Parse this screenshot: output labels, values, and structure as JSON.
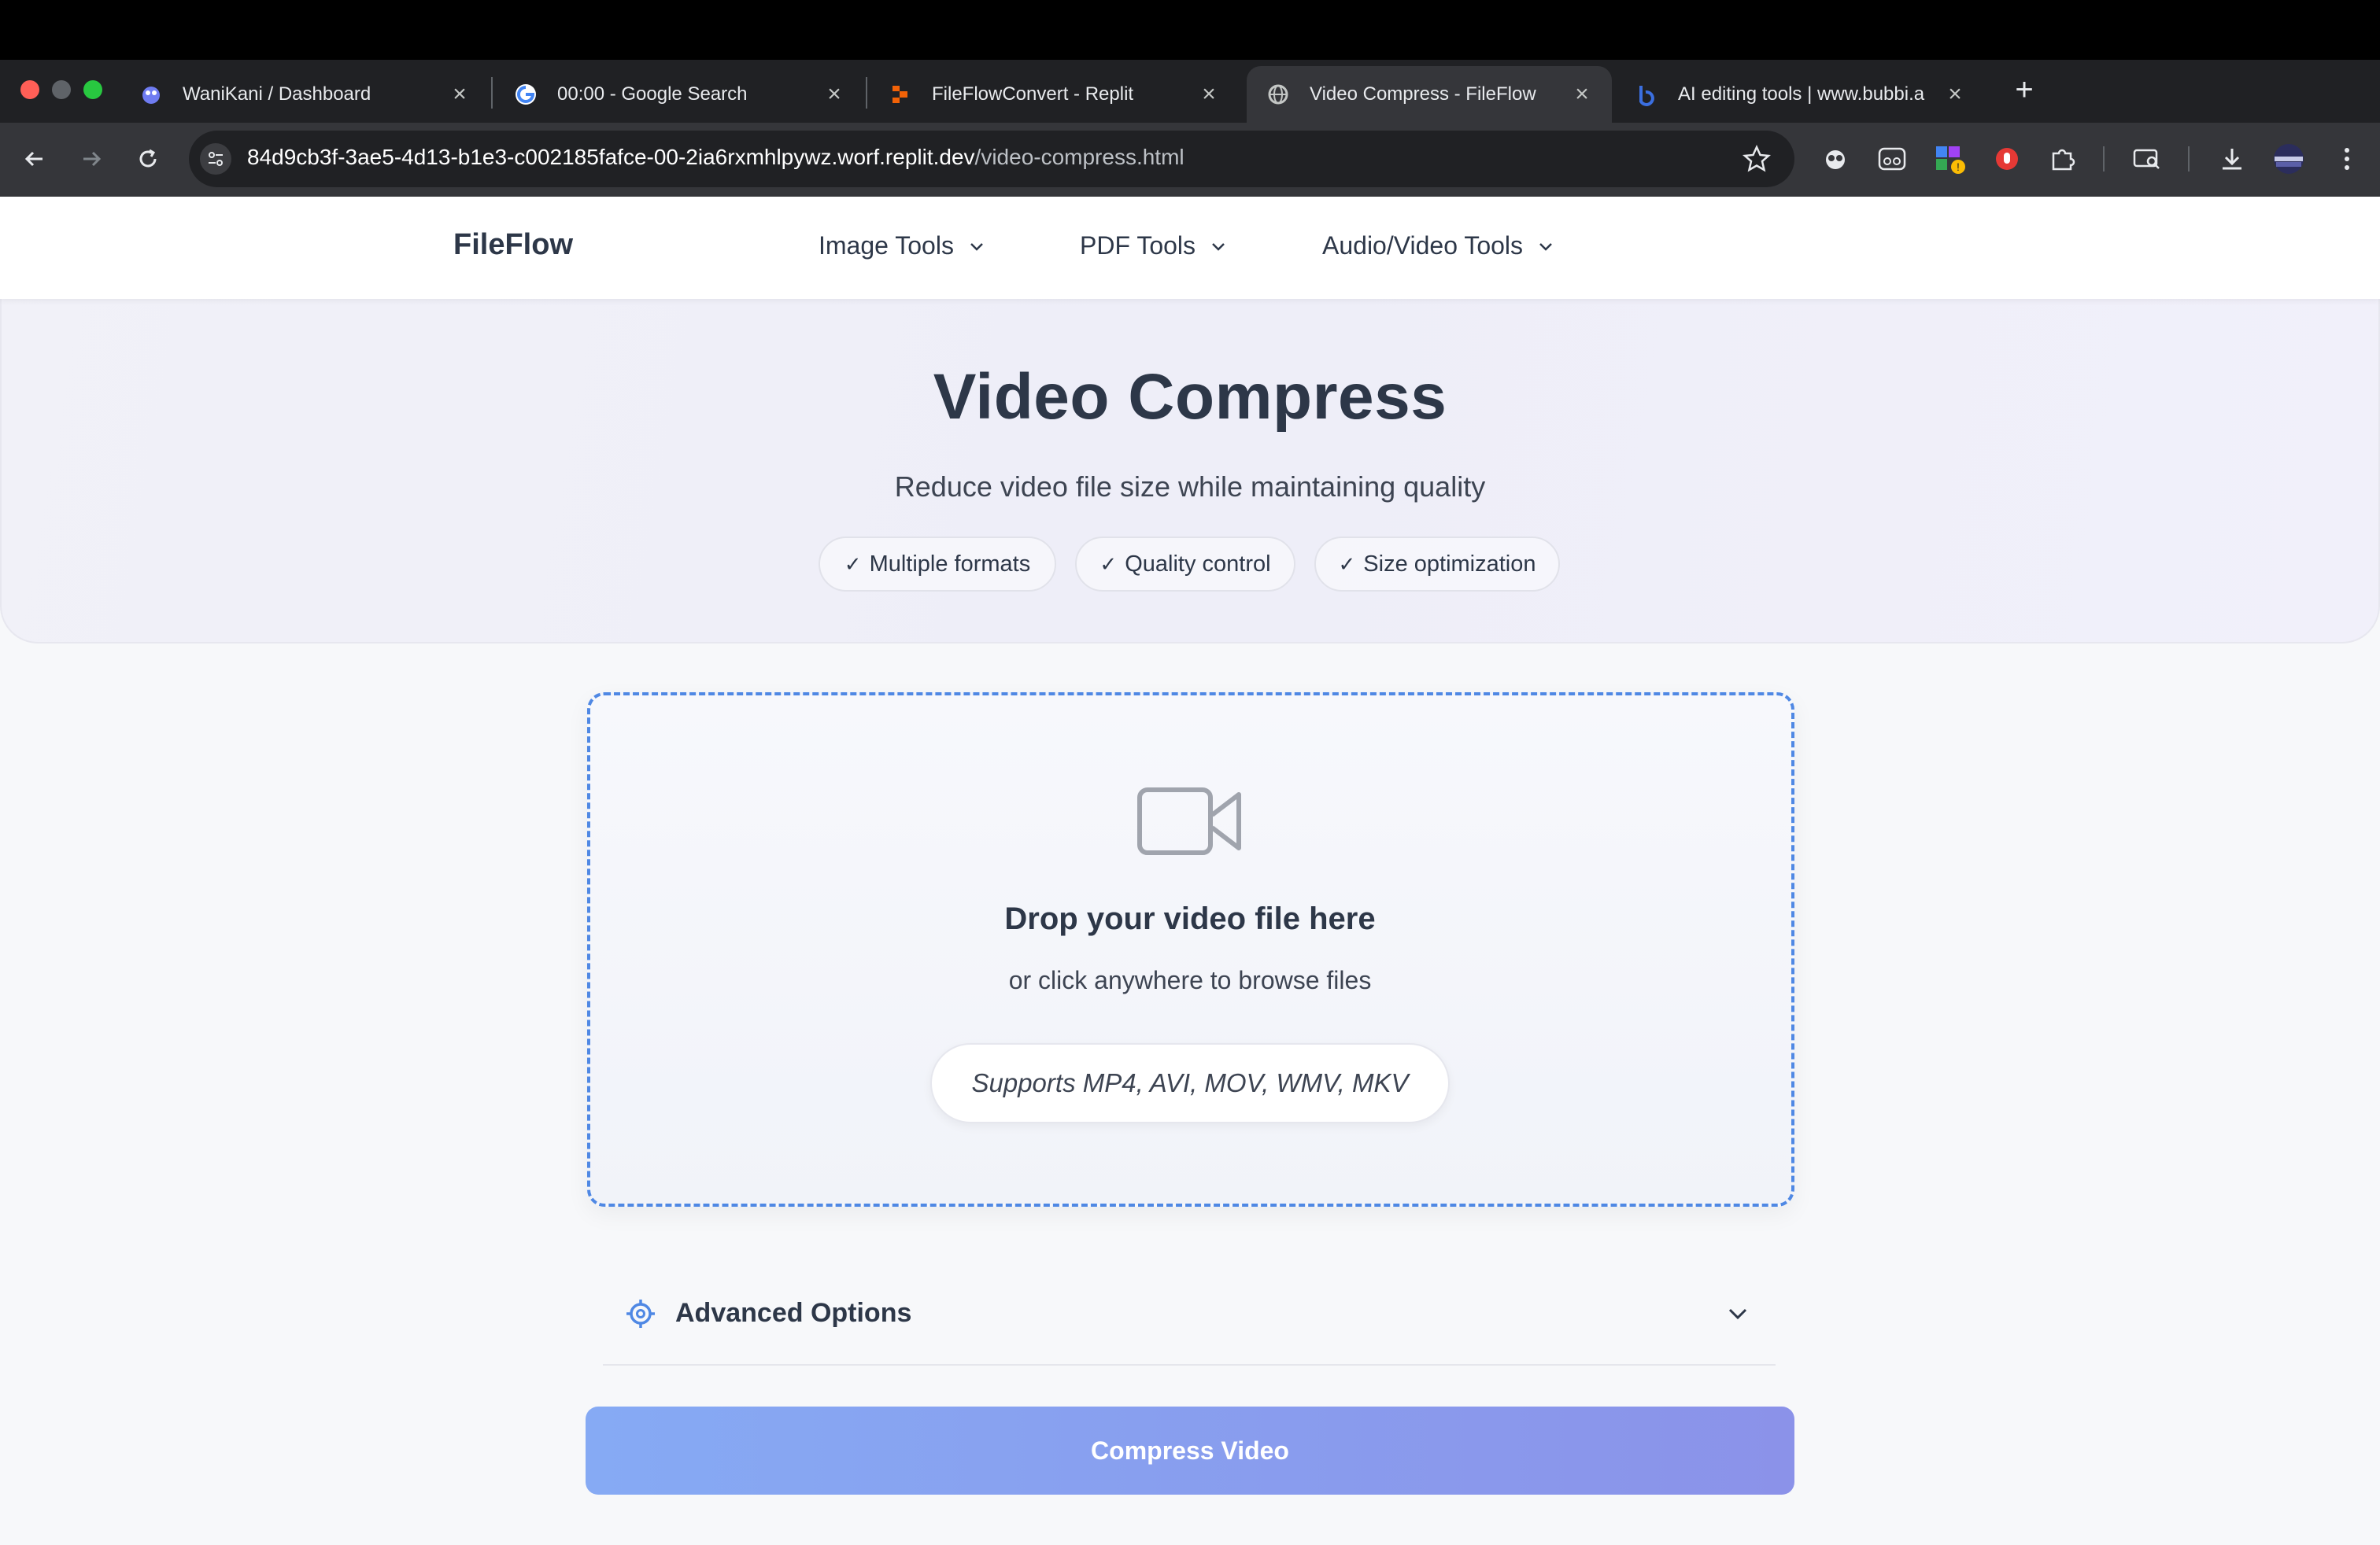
{
  "browser": {
    "tabs": [
      {
        "title": "WaniKani / Dashboard",
        "favicon": "crabigator-icon"
      },
      {
        "title": "00:00 - Google Search",
        "favicon": "google-icon"
      },
      {
        "title": "FileFlowConvert - Replit",
        "favicon": "replit-icon"
      },
      {
        "title": "Video Compress - FileFlow",
        "favicon": "globe-icon",
        "active": true
      },
      {
        "title": "AI editing tools | www.bubbi.a",
        "favicon": "bubbi-icon"
      }
    ],
    "url": {
      "host": "84d9cb3f-3ae5-4d13-b1e3-c002185fafce-00-2ia6rxmhlpywz.worf.replit.dev",
      "path": "/video-compress.html"
    },
    "colors": {
      "chrome_dark": "#202124",
      "toolbar": "#35363a"
    }
  },
  "app": {
    "brand": "FileFlow",
    "nav": [
      {
        "label": "Image Tools"
      },
      {
        "label": "PDF Tools"
      },
      {
        "label": "Audio/Video Tools"
      }
    ]
  },
  "hero": {
    "title": "Video Compress",
    "subtitle": "Reduce video file size while maintaining quality",
    "badges": [
      "Multiple formats",
      "Quality control",
      "Size optimization"
    ]
  },
  "dropzone": {
    "icon": "video-camera-icon",
    "title": "Drop your video file here",
    "subtitle": "or click anywhere to browse files",
    "supports": "Supports MP4, AVI, MOV, WMV, MKV",
    "border_color": "#4f88e4"
  },
  "advanced": {
    "label": "Advanced Options",
    "icon": "gear-icon"
  },
  "cta": {
    "label": "Compress Video",
    "gradient": [
      "#86aaf4",
      "#8b92e9"
    ]
  }
}
